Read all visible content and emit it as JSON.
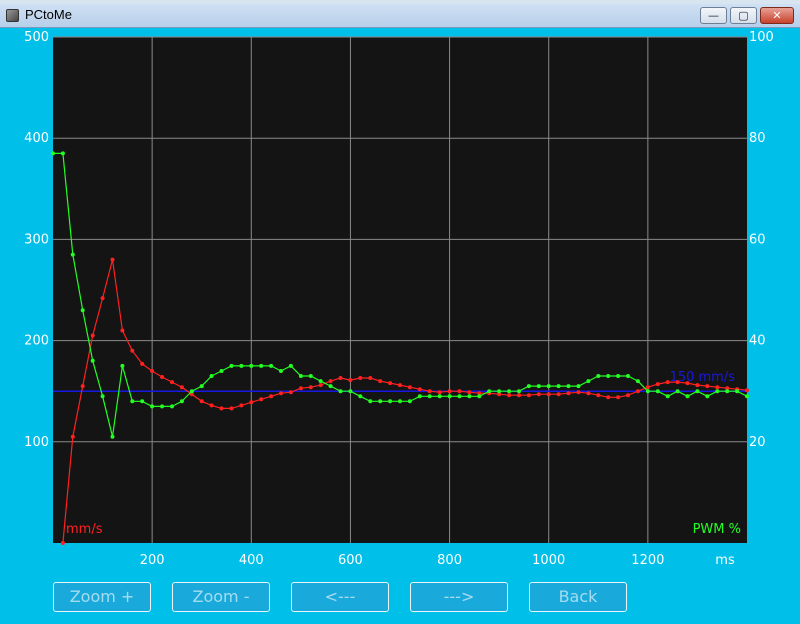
{
  "window": {
    "title": "PCtoMe",
    "minimize_glyph": "—",
    "maximize_glyph": "▢",
    "close_glyph": "✕"
  },
  "buttons": {
    "zoom_in": "Zoom +",
    "zoom_out": "Zoom -",
    "prev": "<---",
    "next": "--->",
    "back": "Back"
  },
  "chart_data": {
    "type": "line",
    "background": "#141414",
    "grid": true,
    "x": {
      "label": "ms",
      "ticks": [
        200,
        400,
        600,
        800,
        1000,
        1200
      ],
      "range": [
        0,
        1400
      ]
    },
    "y_left": {
      "ticks": [
        100,
        200,
        300,
        400,
        500
      ],
      "range": [
        0,
        500
      ],
      "unit_label": "mm/s",
      "color": "#ff2020"
    },
    "y_right": {
      "ticks": [
        20,
        40,
        60,
        80,
        100
      ],
      "range": [
        0,
        100
      ],
      "unit_label": "PWM %",
      "color": "#22ff22"
    },
    "annotation": {
      "text": "150 mm/s",
      "y": 150,
      "color": "#1818e0"
    },
    "series": [
      {
        "color": "#ff2020",
        "axis": "left",
        "points": [
          [
            20,
            0
          ],
          [
            40,
            105
          ],
          [
            60,
            155
          ],
          [
            80,
            205
          ],
          [
            100,
            242
          ],
          [
            120,
            280
          ],
          [
            140,
            210
          ],
          [
            160,
            190
          ],
          [
            180,
            177
          ],
          [
            200,
            170
          ],
          [
            220,
            164
          ],
          [
            240,
            159
          ],
          [
            260,
            154
          ],
          [
            280,
            147
          ],
          [
            300,
            140
          ],
          [
            320,
            136
          ],
          [
            340,
            133
          ],
          [
            360,
            133
          ],
          [
            380,
            136
          ],
          [
            400,
            139
          ],
          [
            420,
            142
          ],
          [
            440,
            145
          ],
          [
            460,
            148
          ],
          [
            480,
            149
          ],
          [
            500,
            153
          ],
          [
            520,
            154
          ],
          [
            540,
            156
          ],
          [
            560,
            160
          ],
          [
            580,
            163
          ],
          [
            600,
            161
          ],
          [
            620,
            163
          ],
          [
            640,
            163
          ],
          [
            660,
            160
          ],
          [
            680,
            158
          ],
          [
            700,
            156
          ],
          [
            720,
            154
          ],
          [
            740,
            152
          ],
          [
            760,
            150
          ],
          [
            780,
            149
          ],
          [
            800,
            150
          ],
          [
            820,
            150
          ],
          [
            840,
            149
          ],
          [
            860,
            148
          ],
          [
            880,
            148
          ],
          [
            900,
            147
          ],
          [
            920,
            146
          ],
          [
            940,
            146
          ],
          [
            960,
            146
          ],
          [
            980,
            147
          ],
          [
            1000,
            147
          ],
          [
            1020,
            147
          ],
          [
            1040,
            148
          ],
          [
            1060,
            149
          ],
          [
            1080,
            148
          ],
          [
            1100,
            146
          ],
          [
            1120,
            144
          ],
          [
            1140,
            144
          ],
          [
            1160,
            146
          ],
          [
            1180,
            150
          ],
          [
            1200,
            154
          ],
          [
            1220,
            157
          ],
          [
            1240,
            159
          ],
          [
            1260,
            159
          ],
          [
            1280,
            158
          ],
          [
            1300,
            156
          ],
          [
            1320,
            155
          ],
          [
            1340,
            154
          ],
          [
            1360,
            153
          ],
          [
            1380,
            152
          ],
          [
            1400,
            151
          ]
        ]
      },
      {
        "color": "#22ff22",
        "axis": "right",
        "points": [
          [
            0,
            77
          ],
          [
            20,
            77
          ],
          [
            40,
            57
          ],
          [
            60,
            46
          ],
          [
            80,
            36
          ],
          [
            100,
            29
          ],
          [
            120,
            21
          ],
          [
            140,
            35
          ],
          [
            160,
            28
          ],
          [
            180,
            28
          ],
          [
            200,
            27
          ],
          [
            220,
            27
          ],
          [
            240,
            27
          ],
          [
            260,
            28
          ],
          [
            280,
            30
          ],
          [
            300,
            31
          ],
          [
            320,
            33
          ],
          [
            340,
            34
          ],
          [
            360,
            35
          ],
          [
            380,
            35
          ],
          [
            400,
            35
          ],
          [
            420,
            35
          ],
          [
            440,
            35
          ],
          [
            460,
            34
          ],
          [
            480,
            35
          ],
          [
            500,
            33
          ],
          [
            520,
            33
          ],
          [
            540,
            32
          ],
          [
            560,
            31
          ],
          [
            580,
            30
          ],
          [
            600,
            30
          ],
          [
            620,
            29
          ],
          [
            640,
            28
          ],
          [
            660,
            28
          ],
          [
            680,
            28
          ],
          [
            700,
            28
          ],
          [
            720,
            28
          ],
          [
            740,
            29
          ],
          [
            760,
            29
          ],
          [
            780,
            29
          ],
          [
            800,
            29
          ],
          [
            820,
            29
          ],
          [
            840,
            29
          ],
          [
            860,
            29
          ],
          [
            880,
            30
          ],
          [
            900,
            30
          ],
          [
            920,
            30
          ],
          [
            940,
            30
          ],
          [
            960,
            31
          ],
          [
            980,
            31
          ],
          [
            1000,
            31
          ],
          [
            1020,
            31
          ],
          [
            1040,
            31
          ],
          [
            1060,
            31
          ],
          [
            1080,
            32
          ],
          [
            1100,
            33
          ],
          [
            1120,
            33
          ],
          [
            1140,
            33
          ],
          [
            1160,
            33
          ],
          [
            1180,
            32
          ],
          [
            1200,
            30
          ],
          [
            1220,
            30
          ],
          [
            1240,
            29
          ],
          [
            1260,
            30
          ],
          [
            1280,
            29
          ],
          [
            1300,
            30
          ],
          [
            1320,
            29
          ],
          [
            1340,
            30
          ],
          [
            1360,
            30
          ],
          [
            1380,
            30
          ],
          [
            1400,
            29
          ]
        ]
      }
    ]
  }
}
